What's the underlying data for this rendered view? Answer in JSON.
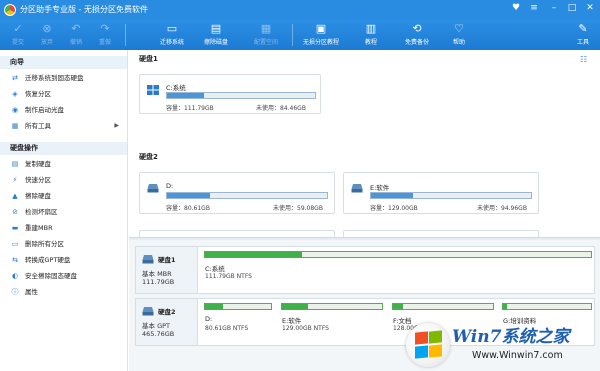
{
  "app": {
    "title": "分区助手专业版 - 无损分区免费软件"
  },
  "colors": {
    "accent": "#2a8ce0",
    "used_blue": "#4d95d9",
    "part_green": "#3fb04a"
  },
  "toolbar": {
    "items": [
      {
        "label": "提交",
        "icon": "submit-icon",
        "enabled": false
      },
      {
        "label": "放弃",
        "icon": "discard-icon",
        "enabled": false
      },
      {
        "label": "撤销",
        "icon": "undo-icon",
        "enabled": false
      },
      {
        "label": "重做",
        "icon": "redo-icon",
        "enabled": false
      },
      {
        "label": "迁移系统",
        "icon": "migrate-os-icon",
        "enabled": true
      },
      {
        "label": "擦除磁盘",
        "icon": "wipe-disk-icon",
        "enabled": true
      },
      {
        "label": "配置空间",
        "icon": "allocate-space-icon",
        "enabled": false
      },
      {
        "label": "无损分区教程",
        "icon": "tutorial-icon",
        "enabled": true
      },
      {
        "label": "教程",
        "icon": "book-icon",
        "enabled": true
      },
      {
        "label": "免费备份",
        "icon": "backup-icon",
        "enabled": true
      },
      {
        "label": "帮助",
        "icon": "help-icon",
        "enabled": true
      },
      {
        "label": "工具",
        "icon": "tools-icon",
        "enabled": true
      }
    ]
  },
  "sidebar": {
    "wizard_header": "向导",
    "wizard_items": [
      {
        "label": "迁移系统到固态硬盘",
        "icon": "migrate-icon"
      },
      {
        "label": "恢复分区",
        "icon": "recover-icon"
      },
      {
        "label": "制作启动光盘",
        "icon": "boot-disc-icon"
      },
      {
        "label": "所有工具",
        "icon": "all-tools-icon",
        "arrow": "▶"
      }
    ],
    "disk_ops_header": "硬盘操作",
    "disk_ops_items": [
      {
        "label": "复制硬盘",
        "icon": "copy-disk-icon"
      },
      {
        "label": "快速分区",
        "icon": "quick-partition-icon"
      },
      {
        "label": "擦除硬盘",
        "icon": "wipe-icon"
      },
      {
        "label": "检测坏扇区",
        "icon": "bad-sector-icon"
      },
      {
        "label": "重建MBR",
        "icon": "mbr-icon"
      },
      {
        "label": "删除所有分区",
        "icon": "delete-all-icon"
      },
      {
        "label": "转换成GPT硬盘",
        "icon": "gpt-icon"
      },
      {
        "label": "安全擦除固态硬盘",
        "icon": "ssd-erase-icon"
      },
      {
        "label": "属性",
        "icon": "info-icon"
      }
    ]
  },
  "disks_panel": {
    "disk1_label": "硬盘1",
    "disk2_label": "硬盘2",
    "cards": [
      {
        "name": "C:系统",
        "capacity": "容量：111.79GB",
        "free": "未使用：84.46GB",
        "used_fraction": 0.25,
        "icon": "windows-drive-icon"
      },
      {
        "name": "D:",
        "capacity": "容量：80.61GB",
        "free": "未使用：59.08GB",
        "used_fraction": 0.27,
        "icon": "drive-icon"
      },
      {
        "name": "E:软件",
        "capacity": "容量：129.00GB",
        "free": "未使用：94.96GB",
        "used_fraction": 0.26,
        "icon": "drive-icon"
      }
    ]
  },
  "disk_map": {
    "rows": [
      {
        "name": "硬盘1",
        "type": "基本 MBR",
        "size": "111.79GB",
        "partitions": [
          {
            "name": "C:系统",
            "info": "111.79GB NTFS",
            "used_fraction": 0.25
          }
        ]
      },
      {
        "name": "硬盘2",
        "type": "基本 GPT",
        "size": "465.76GB",
        "partitions": [
          {
            "name": "D:",
            "info": "80.61GB NTFS",
            "used_fraction": 0.27
          },
          {
            "name": "E:软件",
            "info": "129.00GB NTFS",
            "used_fraction": 0.26
          },
          {
            "name": "F:文档",
            "info": "128.00GB NT",
            "used_fraction": 0.1
          },
          {
            "name": "G:培训资料",
            "info": "",
            "used_fraction": 0.05
          }
        ]
      }
    ]
  },
  "watermark": {
    "brand": "Win7系统之家",
    "url": "Www.Winwin7.com"
  }
}
